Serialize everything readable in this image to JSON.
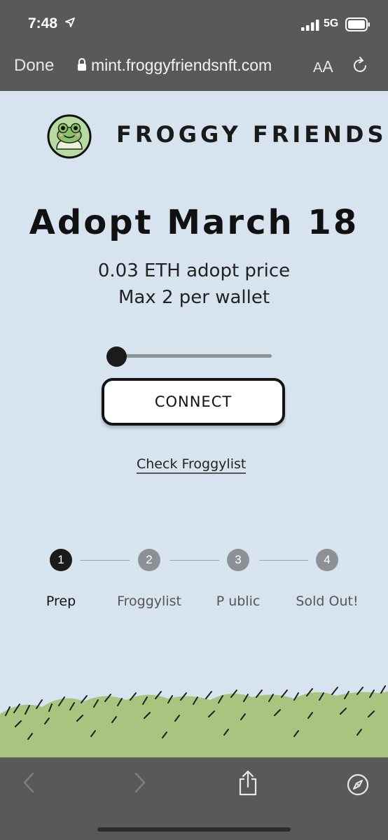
{
  "status_bar": {
    "time": "7:48",
    "network": "5G",
    "location_icon": "location-arrow-icon",
    "signal_icon": "signal-bars-icon",
    "battery_icon": "battery-icon"
  },
  "browser": {
    "done_label": "Done",
    "url": "mint.froggyfriendsnft.com",
    "text_size_small": "A",
    "text_size_large": "A",
    "lock_icon": "lock-icon",
    "reload_icon": "reload-icon"
  },
  "page": {
    "brand": "FROGGY FRIENDS",
    "headline": "Adopt March 18",
    "price": "0.03 ETH adopt price",
    "max": "Max 2 per wallet",
    "slider_value": 0,
    "connect_label": "CONNECT",
    "froggylist_link": "Check Froggylist",
    "steps": [
      {
        "number": "1",
        "label": "Prep",
        "active": true
      },
      {
        "number": "2",
        "label": "Froggylist",
        "active": false
      },
      {
        "number": "3",
        "label": "P ublic",
        "active": false
      },
      {
        "number": "4",
        "label": "Sold Out!",
        "active": false
      }
    ]
  },
  "toolbar": {
    "back_icon": "chevron-left-icon",
    "forward_icon": "chevron-right-icon",
    "share_icon": "share-icon",
    "compass_icon": "compass-icon"
  },
  "colors": {
    "page_background": "#d7e3ee",
    "browser_chrome": "#58595b",
    "active_step": "#1b1b1b",
    "inactive_step": "#8d9094",
    "grass": "#a9c47f"
  }
}
